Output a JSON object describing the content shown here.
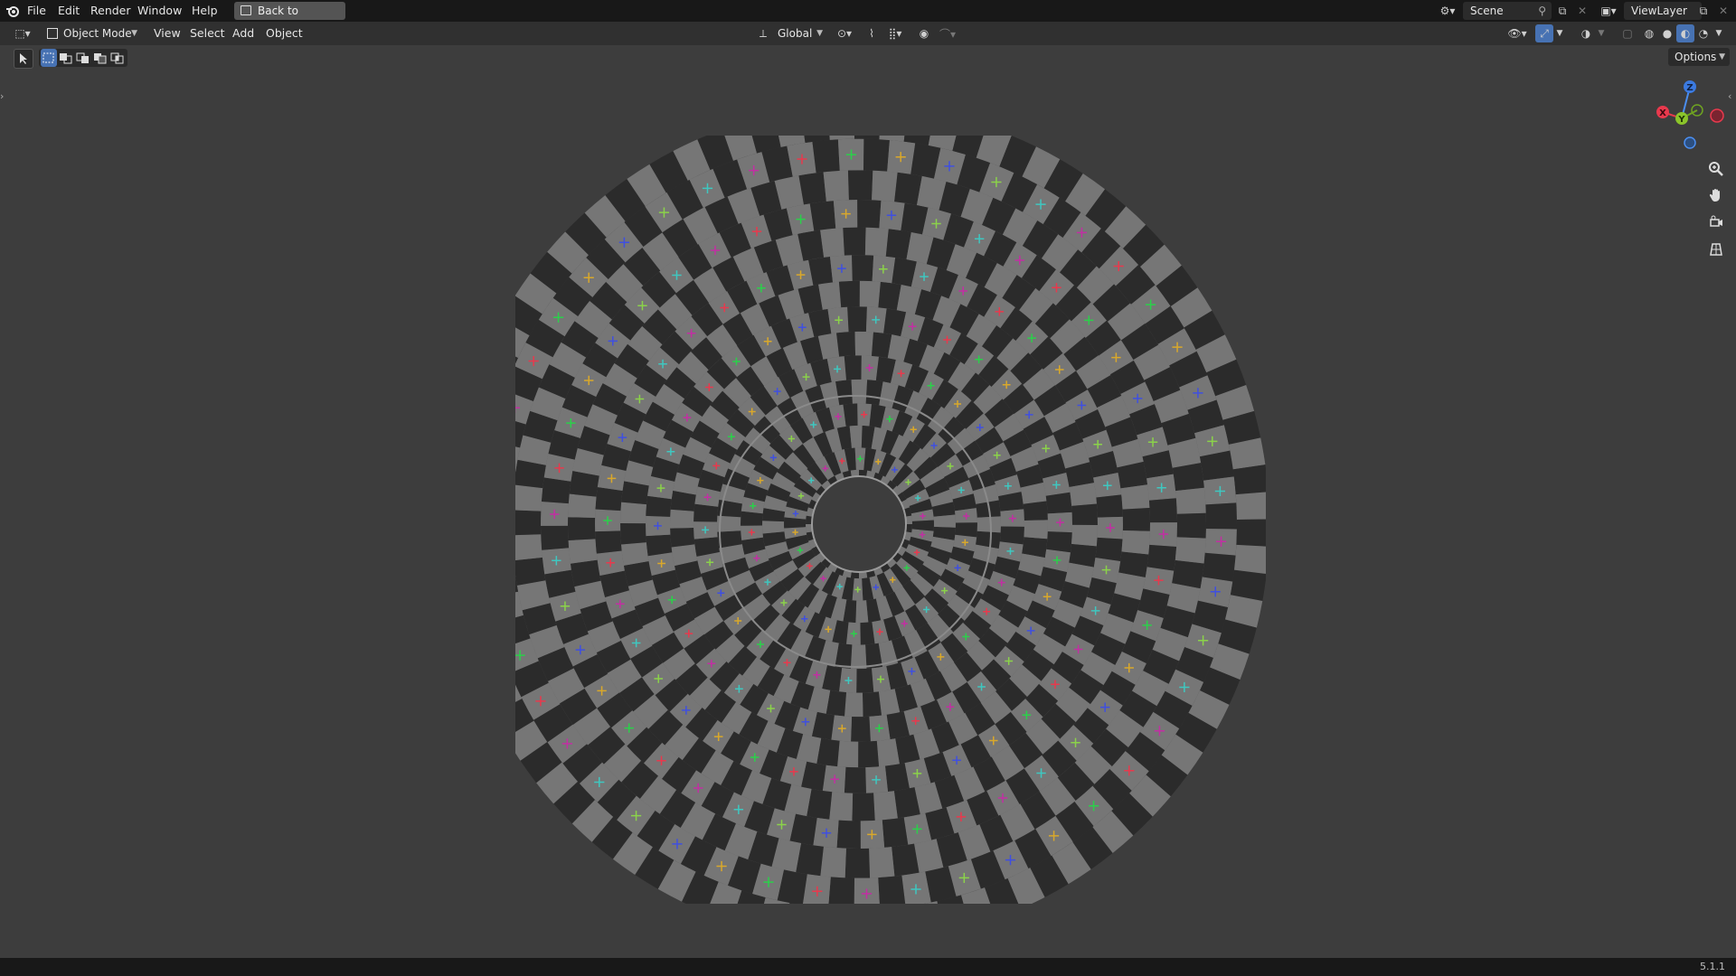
{
  "menu": {
    "file": "File",
    "edit": "Edit",
    "render": "Render",
    "window": "Window",
    "help": "Help",
    "back_to_previous": "Back to Previous"
  },
  "topright": {
    "scene": "Scene",
    "view_layer": "ViewLayer"
  },
  "header": {
    "mode": "Object Mode",
    "view": "View",
    "select": "Select",
    "add": "Add",
    "object": "Object",
    "orientation": "Global",
    "options": "Options"
  },
  "gizmo": {
    "z": "Z",
    "x": "X",
    "y": "Y"
  },
  "status": {
    "version": "5.1.1"
  },
  "viewport": {
    "object": "checker-textured disk",
    "colors": {
      "background": "#3d3d3d",
      "checker_light": "#767676",
      "checker_dark": "#2b2b2b"
    }
  }
}
